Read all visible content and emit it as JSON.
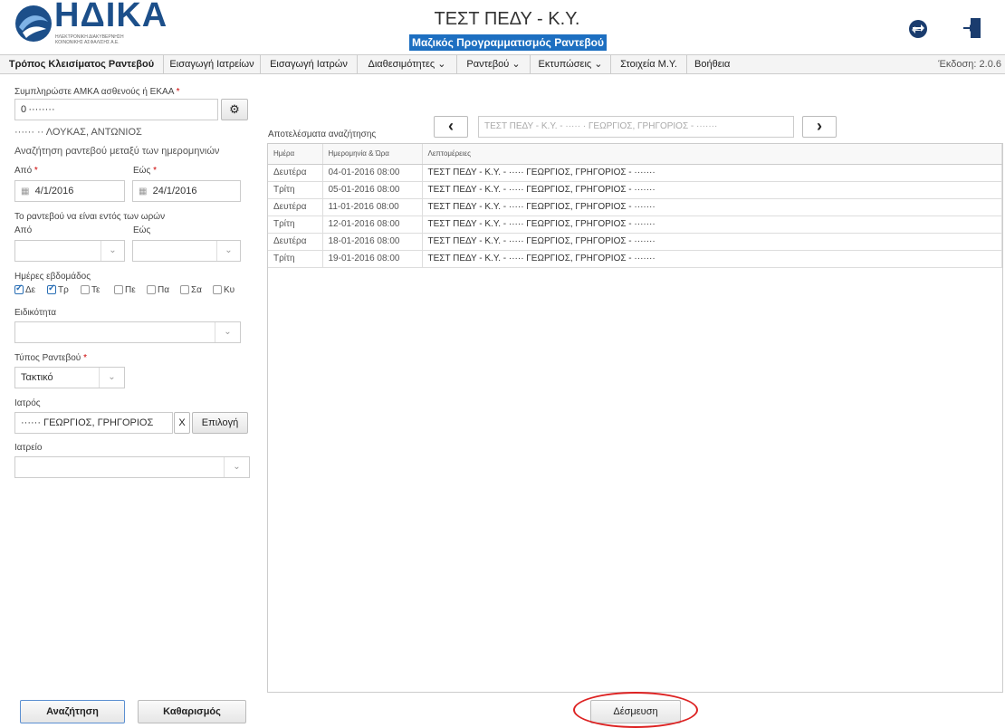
{
  "header": {
    "logo_name": "ΗΔΙΚΑ",
    "logo_sub1": "ΗΛΕΚΤΡΟΝΙΚΗ ΔΙΑΚΥΒΕΡΝΗΣΗ",
    "logo_sub2": "ΚΟΙΝΩΝΙΚΗΣ ΑΣΦΑΛΙΣΗΣ Α.Ε.",
    "title": "ΤΕΣΤ ΠΕΔΥ - Κ.Υ.",
    "subtitle": "Μαζικός Προγραμματισμός Ραντεβού",
    "icon_switch": "switch-arrows-icon",
    "icon_exit": "exit-door-icon",
    "accent": "#1d6fc1",
    "logo_color": "#1c4f8a"
  },
  "nav": {
    "items": [
      {
        "label": "Τρόπος Κλεισίματος Ραντεβού"
      },
      {
        "label": "Εισαγωγή Ιατρείων"
      },
      {
        "label": "Εισαγωγή Ιατρών"
      },
      {
        "label": "Διαθεσιμότητες ⌄"
      },
      {
        "label": "Ραντεβού ⌄"
      },
      {
        "label": "Εκτυπώσεις ⌄"
      },
      {
        "label": "Στοιχεία Μ.Υ."
      },
      {
        "label": "Βοήθεια"
      }
    ],
    "version": "Έκδοση: 2.0.6"
  },
  "form": {
    "amka_label": "Συμπληρώστε ΑΜΚΑ ασθενούς ή ΕΚΑΑ",
    "amka_value": "0 ········",
    "patient_name": "······ ·· ΛΟΥΚΑΣ, ΑΝΤΩΝΙΟΣ",
    "range_heading": "Αναζήτηση ραντεβού μεταξύ των ημερομηνιών",
    "from_label": "Από",
    "to_label": "Εώς",
    "from_value": "4/1/2016",
    "to_value": "24/1/2016",
    "hours_heading": "Το ραντεβού να είναι εντός των ωρών",
    "hour_from_label": "Από",
    "hour_to_label": "Εώς",
    "weekdays_label": "Ημέρες εβδομάδος",
    "weekdays": [
      {
        "label": "Δε",
        "checked": true
      },
      {
        "label": "Τρ",
        "checked": true
      },
      {
        "label": "Τε",
        "checked": false
      },
      {
        "label": "Πε",
        "checked": false
      },
      {
        "label": "Πα",
        "checked": false
      },
      {
        "label": "Σα",
        "checked": false
      },
      {
        "label": "Κυ",
        "checked": false
      }
    ],
    "specialty_label": "Ειδικότητα",
    "type_label": "Τύπος Ραντεβού",
    "type_value": "Τακτικό",
    "doctor_label": "Ιατρός",
    "doctor_value": "······ ΓΕΩΡΓΙΟΣ, ΓΡΗΓΟΡΙΟΣ",
    "doctor_clear": "X",
    "doctor_select": "Επιλογή",
    "clinic_label": "Ιατρείο",
    "search_button": "Αναζήτηση",
    "clear_button": "Καθαρισμός",
    "required_mark": "*"
  },
  "pager": {
    "prev": "‹",
    "next": "›",
    "current": "ΤΕΣΤ ΠΕΔΥ - Κ.Υ. - ····· · ΓΕΩΡΓΙΟΣ, ΓΡΗΓΟΡΙΟΣ - ·······"
  },
  "results": {
    "heading": "Αποτελέσματα αναζήτησης",
    "columns": [
      "Ημέρα",
      "Ημερομηνία & Ώρα",
      "Λεπτομέρειες"
    ],
    "rows": [
      {
        "day": "Δευτέρα",
        "datetime": "04-01-2016 08:00",
        "details": "ΤΕΣΤ ΠΕΔΥ - Κ.Υ. - ····· ΓΕΩΡΓΙΟΣ, ΓΡΗΓΟΡΙΟΣ - ·······"
      },
      {
        "day": "Τρίτη",
        "datetime": "05-01-2016 08:00",
        "details": "ΤΕΣΤ ΠΕΔΥ - Κ.Υ. - ····· ΓΕΩΡΓΙΟΣ, ΓΡΗΓΟΡΙΟΣ - ·······"
      },
      {
        "day": "Δευτέρα",
        "datetime": "11-01-2016 08:00",
        "details": "ΤΕΣΤ ΠΕΔΥ - Κ.Υ. - ····· ΓΕΩΡΓΙΟΣ, ΓΡΗΓΟΡΙΟΣ - ·······"
      },
      {
        "day": "Τρίτη",
        "datetime": "12-01-2016 08:00",
        "details": "ΤΕΣΤ ΠΕΔΥ - Κ.Υ. - ····· ΓΕΩΡΓΙΟΣ, ΓΡΗΓΟΡΙΟΣ - ·······"
      },
      {
        "day": "Δευτέρα",
        "datetime": "18-01-2016 08:00",
        "details": "ΤΕΣΤ ΠΕΔΥ - Κ.Υ. - ····· ΓΕΩΡΓΙΟΣ, ΓΡΗΓΟΡΙΟΣ - ·······"
      },
      {
        "day": "Τρίτη",
        "datetime": "19-01-2016 08:00",
        "details": "ΤΕΣΤ ΠΕΔΥ - Κ.Υ. - ····· ΓΕΩΡΓΙΟΣ, ΓΡΗΓΟΡΙΟΣ - ·······"
      }
    ]
  },
  "footer": {
    "commit_button": "Δέσμευση",
    "annotation_color": "#d22222"
  }
}
